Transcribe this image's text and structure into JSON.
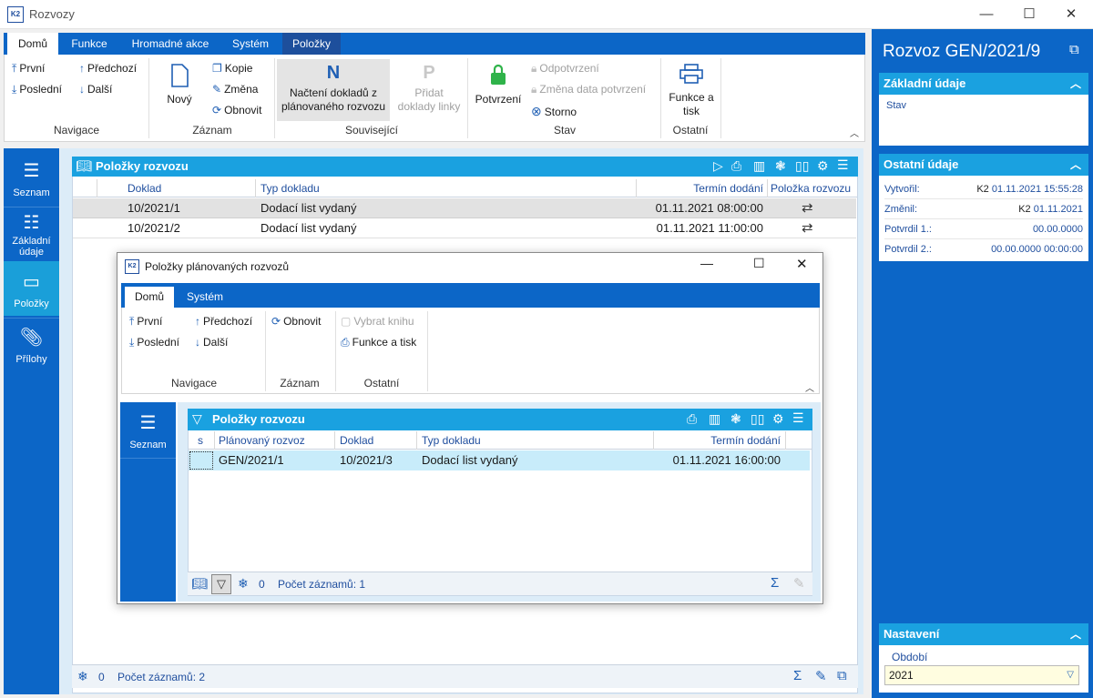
{
  "window": {
    "title": "Rozvozy",
    "minimize": "—",
    "maximize": "☐",
    "close": "✕",
    "logo": "K2"
  },
  "ribbon": {
    "tabs": [
      "Domů",
      "Funkce",
      "Hromadné akce",
      "Systém",
      "Položky"
    ],
    "nav": {
      "first": "První",
      "last": "Poslední",
      "prev": "Předchozí",
      "next": "Další",
      "label": "Navigace"
    },
    "record": {
      "new": "Nový",
      "copy": "Kopie",
      "change": "Změna",
      "refresh": "Obnovit",
      "label": "Záznam"
    },
    "related": {
      "load": "Načtení dokladů z plánovaného rozvozu",
      "load_l1": "Načtení dokladů z",
      "load_l2": "plánovaného rozvozu",
      "add_l1": "Přidat",
      "add_l2": "doklady linky",
      "label": "Související",
      "n_letter": "N",
      "p_letter": "P"
    },
    "state": {
      "confirm": "Potvrzení",
      "unconfirm": "Odpotvrzení",
      "change_date": "Změna data potvrzení",
      "cancel": "Storno",
      "label": "Stav"
    },
    "other": {
      "func_l1": "Funkce a",
      "func_l2": "tisk",
      "label": "Ostatní"
    }
  },
  "sidebar": {
    "items": [
      {
        "label": "Seznam",
        "icon": "list-icon"
      },
      {
        "label_l1": "Základní",
        "label_l2": "údaje",
        "icon": "details-icon"
      },
      {
        "label": "Položky",
        "icon": "box-icon"
      },
      {
        "label": "Přílohy",
        "icon": "paperclip-icon"
      }
    ]
  },
  "panel": {
    "title": "Položky rozvozu",
    "columns": [
      "Doklad",
      "Typ dokladu",
      "Termín dodání",
      "Položka rozvozu"
    ],
    "rows": [
      {
        "doc": "10/2021/1",
        "type": "Dodací list vydaný",
        "date": "01.11.2021 08:00:00",
        "link": "⇄"
      },
      {
        "doc": "10/2021/2",
        "type": "Dodací list vydaný",
        "date": "01.11.2021 11:00:00",
        "link": "⇄"
      }
    ],
    "status": {
      "filter_count": "0",
      "records": "Počet záznamů: 2"
    }
  },
  "right": {
    "title": "Rozvoz GEN/2021/9",
    "basic": {
      "title": "Základní údaje",
      "state_label": "Stav"
    },
    "other": {
      "title": "Ostatní údaje",
      "created_label": "Vytvořil:",
      "created_user": "K2",
      "created_date": "01.11.2021 15:55:28",
      "changed_label": "Změnil:",
      "changed_user": "K2",
      "changed_date": "01.11.2021",
      "conf1_label": "Potvrdil 1.:",
      "conf1_val": "00.00.0000",
      "conf2_label": "Potvrdil 2.:",
      "conf2_val": "00.00.0000 00:00:00"
    },
    "settings": {
      "title": "Nastavení",
      "period_label": "Období",
      "period_value": "2021"
    }
  },
  "dialog": {
    "title": "Položky plánovaných rozvozů",
    "logo": "K2",
    "tabs": [
      "Domů",
      "Systém"
    ],
    "nav": {
      "first": "První",
      "last": "Poslední",
      "prev": "Předchozí",
      "next": "Další",
      "label": "Navigace"
    },
    "record": {
      "refresh": "Obnovit",
      "label": "Záznam"
    },
    "other": {
      "select_book": "Vybrat knihu",
      "func": "Funkce a tisk",
      "label": "Ostatní"
    },
    "sidebar_label": "Seznam",
    "panel_title": "Položky rozvozu",
    "columns": [
      "s",
      "Plánovaný rozvoz",
      "Doklad",
      "Typ dokladu",
      "Termín dodání"
    ],
    "rows": [
      {
        "plan": "GEN/2021/1",
        "doc": "10/2021/3",
        "type": "Dodací list vydaný",
        "date": "01.11.2021 16:00:00"
      }
    ],
    "status": {
      "filter_count": "0",
      "records": "Počet záznamů: 1"
    }
  }
}
